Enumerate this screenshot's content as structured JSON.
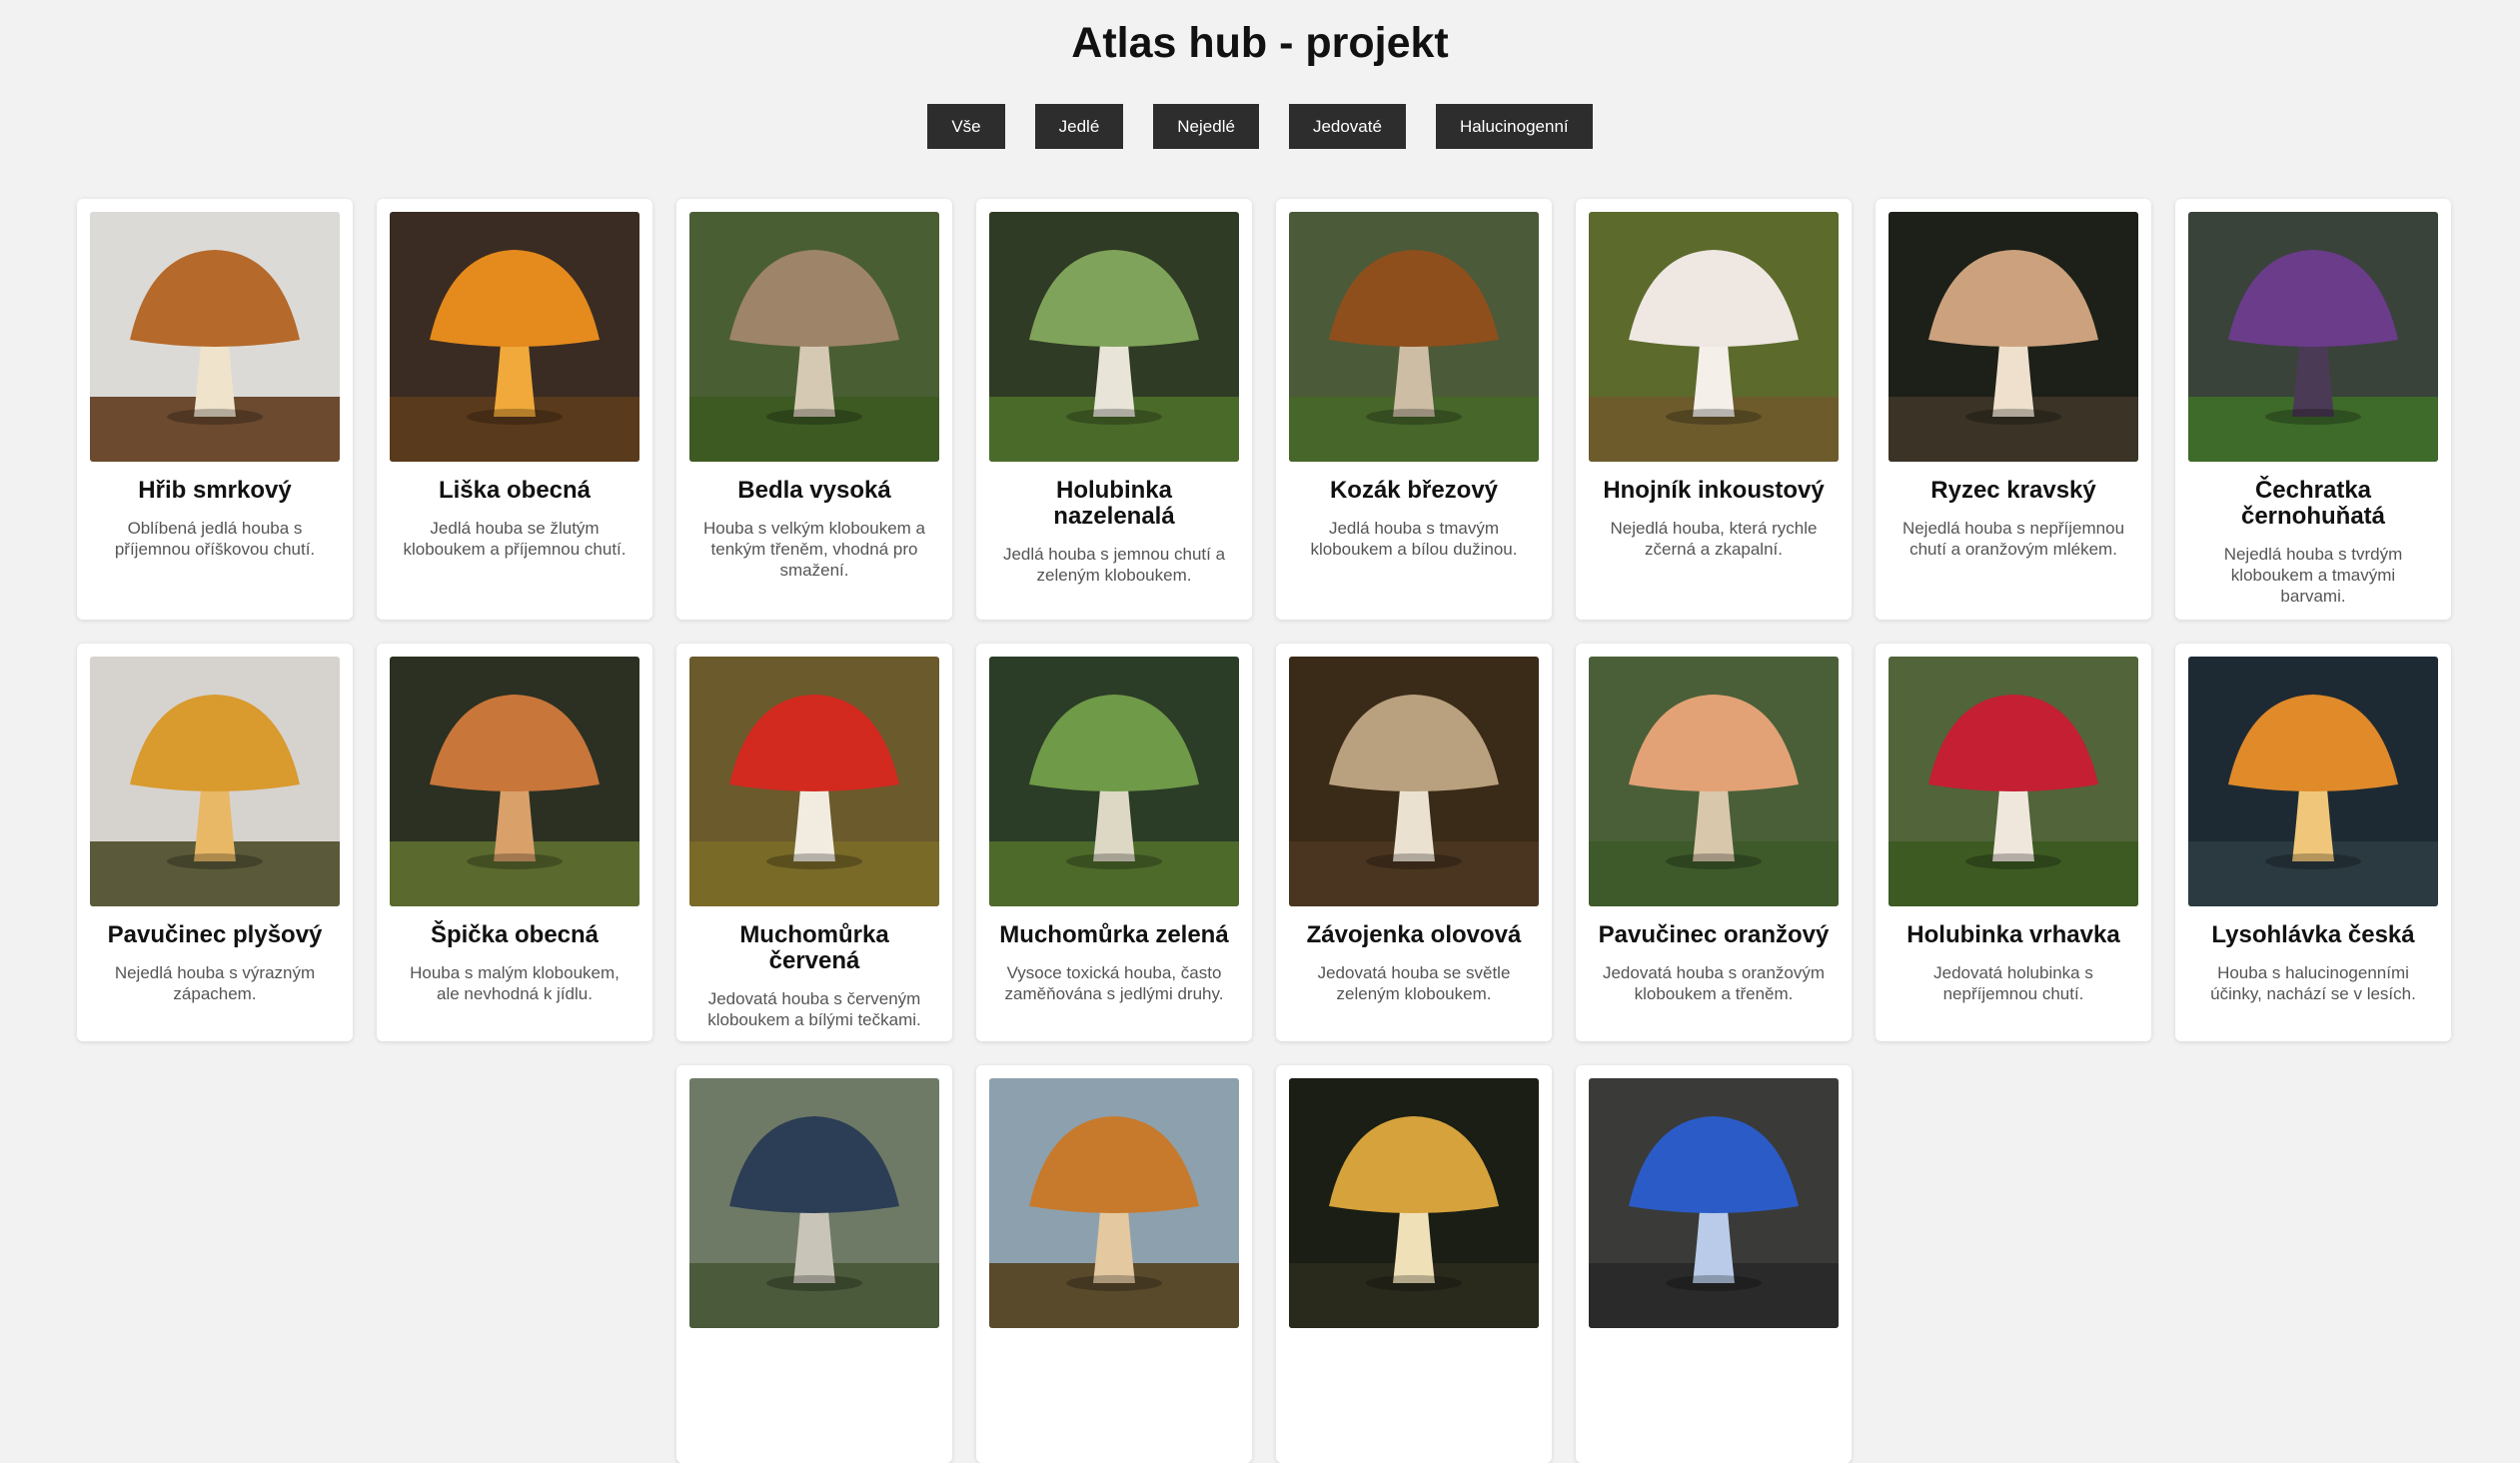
{
  "page": {
    "title": "Atlas hub - projekt"
  },
  "filters": [
    {
      "label": "Vše"
    },
    {
      "label": "Jedlé"
    },
    {
      "label": "Nejedlé"
    },
    {
      "label": "Jedovaté"
    },
    {
      "label": "Halucinogenní"
    }
  ],
  "mushrooms": [
    {
      "name": "Hřib smrkový",
      "description": "Oblíbená jedlá houba s příjemnou oříškovou chutí.",
      "bg": "#dcdad6",
      "cap": "#b5692a",
      "stem": "#efe3cc",
      "ground": "#6b4a2f"
    },
    {
      "name": "Liška obecná",
      "description": "Jedlá houba se žlutým kloboukem a příjemnou chutí.",
      "bg": "#3a2c22",
      "cap": "#e58a1c",
      "stem": "#f0a93a",
      "ground": "#5a3a1c"
    },
    {
      "name": "Bedla vysoká",
      "description": "Houba s velkým kloboukem a tenkým třeněm, vhodná pro smažení.",
      "bg": "#4a5e34",
      "cap": "#9e8468",
      "stem": "#d6c9b3",
      "ground": "#3d5a22"
    },
    {
      "name": "Holubinka nazelenalá",
      "description": "Jedlá houba s jemnou chutí a zeleným kloboukem.",
      "bg": "#2f3b24",
      "cap": "#7fa35a",
      "stem": "#e8e4d8",
      "ground": "#4a6a2a"
    },
    {
      "name": "Kozák březový",
      "description": "Jedlá houba s tmavým kloboukem a bílou dužinou.",
      "bg": "#4b5a38",
      "cap": "#8e4f1d",
      "stem": "#cdbda5",
      "ground": "#46662a"
    },
    {
      "name": "Hnojník inkoustový",
      "description": "Nejedlá houba, která rychle zčerná a zkapalní.",
      "bg": "#5c6a2c",
      "cap": "#eee7e2",
      "stem": "#f4efe8",
      "ground": "#6d5b2c"
    },
    {
      "name": "Ryzec kravský",
      "description": "Nejedlá houba s nepříjemnou chutí a oranžovým mlékem.",
      "bg": "#1d2018",
      "cap": "#cba27d",
      "stem": "#eee0cc",
      "ground": "#3a3326"
    },
    {
      "name": "Čechratka černohuňatá",
      "description": "Nejedlá houba s tvrdým kloboukem a tmavými barvami.",
      "bg": "#39433a",
      "cap": "#6a3c8a",
      "stem": "#4b3a55",
      "ground": "#3e6a2a"
    },
    {
      "name": "Pavučinec plyšový",
      "description": "Nejedlá houba s výrazným zápachem.",
      "bg": "#d6d3cf",
      "cap": "#d99a2e",
      "stem": "#e8b866",
      "ground": "#5a5a3a"
    },
    {
      "name": "Špička obecná",
      "description": "Houba s malým kloboukem, ale nevhodná k jídlu.",
      "bg": "#2b3022",
      "cap": "#c8763a",
      "stem": "#d9a06a",
      "ground": "#5a6a2e"
    },
    {
      "name": "Muchomůrka červená",
      "description": "Jedovatá houba s červeným kloboukem a bílými tečkami.",
      "bg": "#6a5a2c",
      "cap": "#d22a1f",
      "stem": "#f2ece0",
      "ground": "#7a6a28"
    },
    {
      "name": "Muchomůrka zelená",
      "description": "Vysoce toxická houba, často zaměňována s jedlými druhy.",
      "bg": "#2b3c27",
      "cap": "#6f9a48",
      "stem": "#ddd8c4",
      "ground": "#4d6a2a"
    },
    {
      "name": "Závojenka olovová",
      "description": "Jedovatá houba se světle zeleným kloboukem.",
      "bg": "#3a2a18",
      "cap": "#b9a07e",
      "stem": "#ebe1d0",
      "ground": "#4a3520"
    },
    {
      "name": "Pavučinec oranžový",
      "description": "Jedovatá houba s oranžovým kloboukem a třeněm.",
      "bg": "#4a5f38",
      "cap": "#e2a276",
      "stem": "#d9c7ac",
      "ground": "#3e5a2a"
    },
    {
      "name": "Holubinka vrhavka",
      "description": "Jedovatá holubinka s nepříjemnou chutí.",
      "bg": "#51643a",
      "cap": "#c41f33",
      "stem": "#efe7dc",
      "ground": "#3d5a22"
    },
    {
      "name": "Lysohlávka česká",
      "description": "Houba s halucinogenními účinky, nachází se v lesích.",
      "bg": "#1e2a33",
      "cap": "#e08a2a",
      "stem": "#f0c77a",
      "ground": "#2a3a40"
    },
    {
      "name": "",
      "description": "",
      "bg": "#6f7a66",
      "cap": "#2c3e55",
      "stem": "#c8c4b8",
      "ground": "#4a5a3a"
    },
    {
      "name": "",
      "description": "",
      "bg": "#8da0ae",
      "cap": "#c77a2c",
      "stem": "#e3c8a0",
      "ground": "#5a4a2c"
    },
    {
      "name": "",
      "description": "",
      "bg": "#1a1e14",
      "cap": "#d6a23c",
      "stem": "#efe0b8",
      "ground": "#2a2a1c"
    },
    {
      "name": "",
      "description": "",
      "bg": "#3a3a38",
      "cap": "#2b5bc7",
      "stem": "#b9cbe8",
      "ground": "#2a2a2a"
    }
  ]
}
